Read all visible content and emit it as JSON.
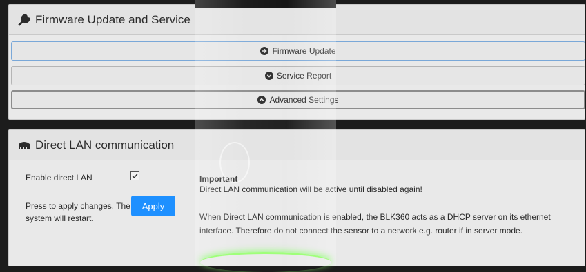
{
  "firmware_panel": {
    "title": "Firmware Update and Service",
    "buttons": {
      "firmware": "Firmware Update",
      "service": "Service Report",
      "advanced": "Advanced Settings"
    }
  },
  "lan_panel": {
    "title": "Direct LAN communication",
    "enable_label": "Enable direct LAN",
    "enable_checked": true,
    "apply_hint": "Press to apply changes. The system will restart.",
    "apply_button": "Apply",
    "important_title": "Important",
    "important_line1": "Direct LAN communication will be active until disabled again!",
    "important_line2": "When Direct LAN communication is enabled, the BLK360 acts as a DHCP server on its ethernet interface. Therefore do not connect the sensor to a network e.g. router if in server mode."
  },
  "colors": {
    "accent": "#1e90ff",
    "panel_bg": "#e9e9e9",
    "page_bg": "#1c1c1c"
  }
}
